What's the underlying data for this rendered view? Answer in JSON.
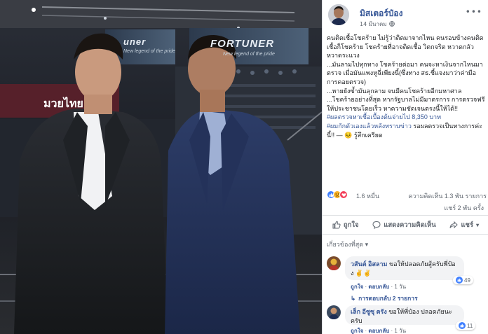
{
  "photo": {
    "banner_left": "มวยไทย",
    "banner_center_brand": "FORTUNER",
    "banner_center_tagline": "New legend of the pride",
    "banner_left_brand": "uner",
    "banner_left_tagline": "New legend of the pride"
  },
  "post": {
    "author": "มิสเตอร์ป๋อง",
    "date": "14 มีนาคม",
    "text_paragraphs": [
      "คนติดเชื้อโชคร้าย ไม่รู้ว่าติดมาจากไหน คนรอบข้างคนติดเชื้อก็โชคร้าย โชคร้ายที่อาจติดเชื้อ วิตกจริต หวาดกลัว หวาดระแวง",
      "...มันลามไปทุกทาง โชคร้ายต่อมา คนจะหาเงินจากไหนมาตรวจ เมื่อมันแพงหูฉี่เพียงนี้(ซึ่งทาง สธ.ชี้แจงมาว่าค่ามือการคอยตรวจ)",
      "...หายยังซ้ำมันลุกลาม จนมีคนโชคร้ายอีกมหาศาล",
      "...โชคร้ายอย่างที่สุด หากรัฐบาลไม่มีมาตรการ การตรวจฟรีให้ประชาชนโดยเร็ว หาความชัดเจนตรงนี้ให้ได้!!"
    ],
    "hashtag1": "#ผลตรวจหาเชื้อเบื้องต้นจ่ายไป 8,350 บาท",
    "hashtag2": "#ผมกักตัวเองแล้วหลังทราบข่าว",
    "trailing": " รอผลตรวจเป็นทางการค่ะนี้!! — ",
    "feeling": "😣 รู้สึกเครียด"
  },
  "stats": {
    "reaction_count": "1.6 หมื่น",
    "comments_label": "ความคิดเห็น 1.3 พัน รายการ",
    "shares_label": "แชร์ 2 พัน ครั้ง"
  },
  "actions": {
    "like": "ถูกใจ",
    "comment": "แสดงความคิดเห็น",
    "share": "แชร์"
  },
  "relevant_label": "เกี่ยวข้องที่สุด ▾",
  "comments": [
    {
      "name": "วสันต์ อิสลาม",
      "text": "ขอให้ปลอดภัยสู้ครับพี่ป๋อง ✌✌",
      "likes": "49",
      "like_label": "ถูกใจ",
      "reply_label": "ตอบกลับ",
      "time": "1 วัน",
      "replies": "การตอบกลับ 2 รายการ"
    },
    {
      "name": "เล็ก อีซูซุ ตรัง",
      "text": "ขอให้พี่ป๋อง ปลอดภัยนะครับ",
      "likes": "11",
      "like_label": "ถูกใจ",
      "reply_label": "ตอบกลับ",
      "time": "1 วัน"
    }
  ],
  "colors": {
    "link": "#385898",
    "meta": "#606770",
    "like_blue": "#4080ff"
  }
}
